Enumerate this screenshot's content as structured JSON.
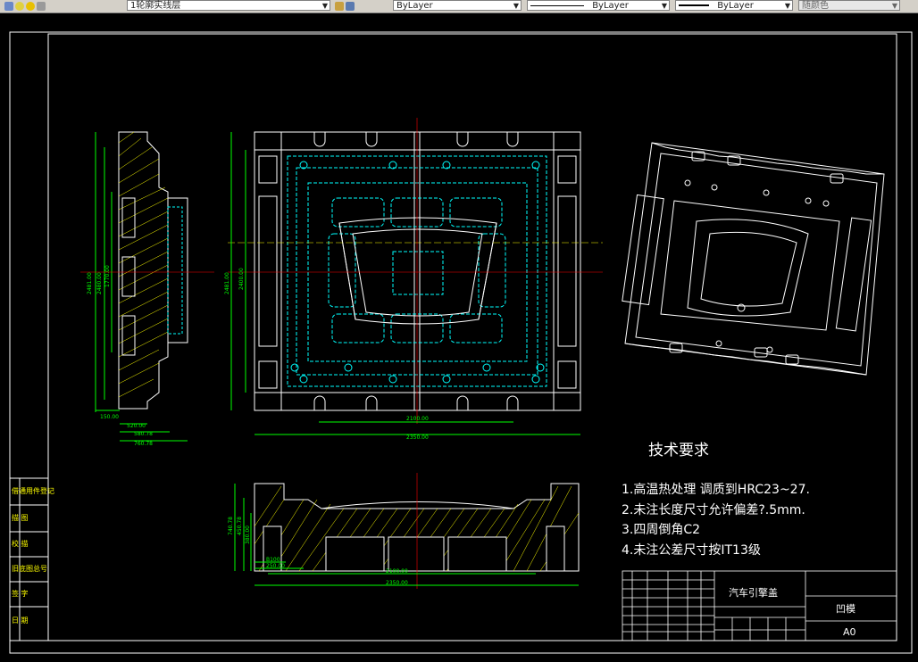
{
  "toolbar": {
    "layer_name": "1轮廓实线层",
    "color_combo": "ByLayer",
    "linetype_combo": "ByLayer",
    "lineweight_combo": "ByLayer",
    "plotstyle_combo": "随颜色"
  },
  "drawing": {
    "tech_title": "技术要求",
    "tech_notes": [
      "1.高温热处理   调质到HRC23~27.",
      "2.未注长度尺寸允许偏差?.5mm.",
      "3.四周倒角C2",
      "4.未注公差尺寸按IT13级"
    ],
    "part_name": "汽车引擎盖",
    "part_type": "凹模",
    "sheet_size": "A0",
    "side_labels": [
      "借通用件登记",
      "描    图",
      "校    描",
      "旧底图总号",
      "签    字",
      "日    期"
    ],
    "dims": {
      "top_width": "2100.00",
      "overall_width": "2350.00",
      "left_h1": "2481.00",
      "left_h2": "2480.00",
      "left_h3": "1770.00",
      "plan_h": "2481.00",
      "plan_h2": "2400.00",
      "side_w1": "150.00",
      "side_w2": "520.00",
      "side_w3": "580.78",
      "side_w4": "760.78",
      "front_w1": "2100.00",
      "front_w2": "2350.00",
      "front_h1": "740.78",
      "front_h2": "450.78",
      "front_h3": "380.00",
      "front_b1": "B100",
      "front_b2": "250.00"
    }
  }
}
